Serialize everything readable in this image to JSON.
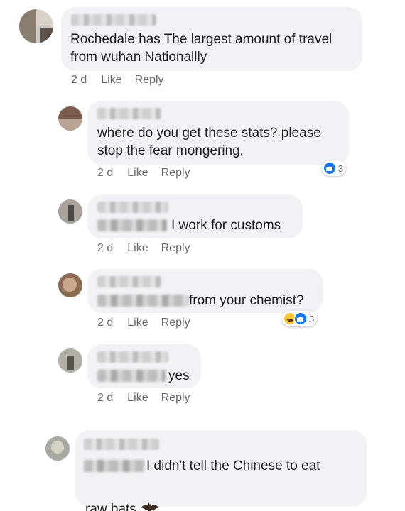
{
  "comments": [
    {
      "text": "Rochedale has The largest amount of travel\nfrom wuhan Nationallly",
      "time": "2 d",
      "like": "Like",
      "reply": "Reply"
    },
    {
      "text": "where do you get these stats? please\nstop the fear mongering.",
      "time": "2 d",
      "like": "Like",
      "reply": "Reply",
      "reaction_count": "3",
      "reaction_icons": [
        "like-icon"
      ]
    },
    {
      "text": "I work for customs",
      "time": "2 d",
      "like": "Like",
      "reply": "Reply"
    },
    {
      "text": "from your chemist?",
      "time": "2 d",
      "like": "Like",
      "reply": "Reply",
      "reaction_count": "3",
      "reaction_icons": [
        "haha-icon",
        "like-icon"
      ]
    },
    {
      "text": "yes",
      "time": "2 d",
      "like": "Like",
      "reply": "Reply"
    },
    {
      "text_line1": "I didn't tell the Chinese to eat",
      "text_line2": "raw bats",
      "emoji": "bat-icon"
    }
  ],
  "colors": {
    "bubble": "#f0f2f5",
    "meta_text": "#65676b",
    "like_blue": "#1877f2"
  }
}
